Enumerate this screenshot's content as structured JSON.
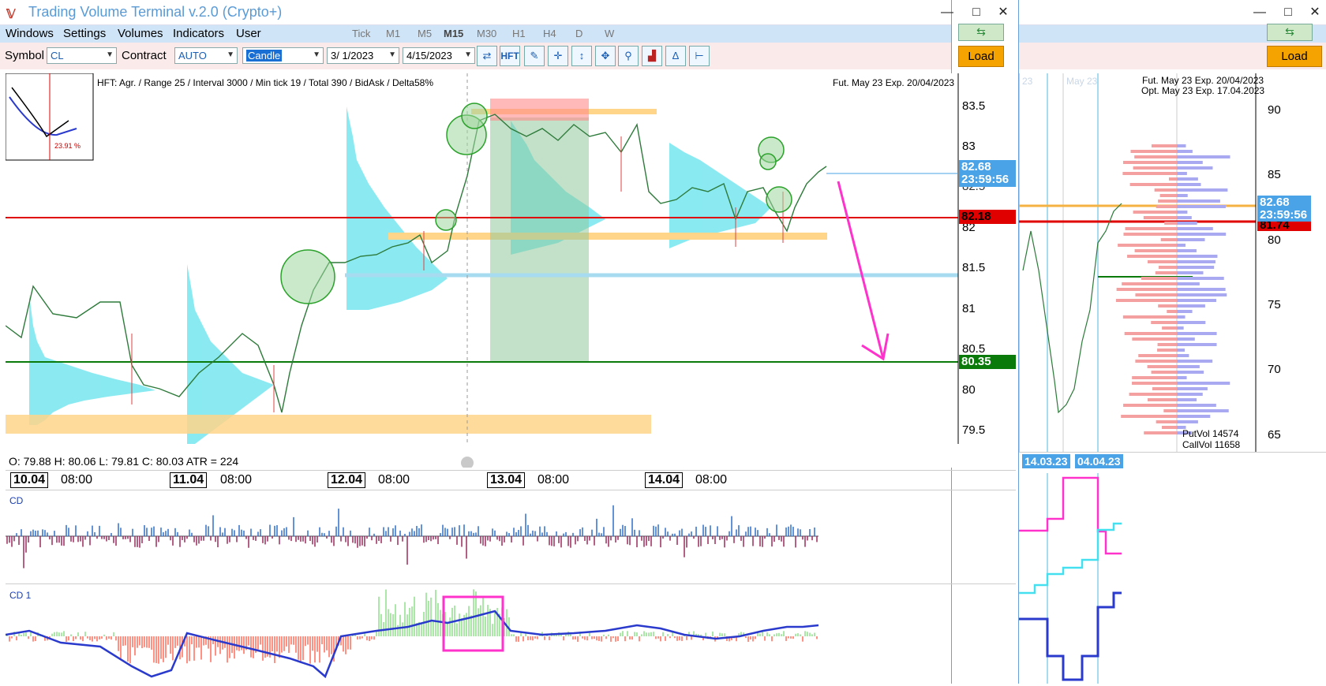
{
  "app": {
    "title": "Trading Volume Terminal v.2.0 (Crypto+)",
    "minimize": "—",
    "maximize": "□",
    "close": "✕"
  },
  "menu": [
    "Windows",
    "Settings",
    "Volumes",
    "Indicators",
    "User"
  ],
  "timeframes": [
    "Tick",
    "M1",
    "M5",
    "M15",
    "M30",
    "H1",
    "H4",
    "D",
    "W"
  ],
  "active_timeframe": "M15",
  "toolbar": {
    "symbol_label": "Symbol",
    "symbol_value": "CL",
    "contract_label": "Contract",
    "contract_value": "AUTO",
    "chart_type": "Candle",
    "date_from": "3/ 1/2023",
    "date_to": "4/15/2023",
    "hft_label": "HFT",
    "load_label": "Load",
    "tool_icons": [
      "arrows-icon",
      "hft-icon",
      "pen-icon",
      "crosshair-icon",
      "fit-vertical-icon",
      "move-icon",
      "zoom-icon",
      "bars-icon",
      "delta-icon",
      "range-icon"
    ]
  },
  "main_chart": {
    "info_line": "HFT: Agr. / Range 25 / Interval 3000 / Min tick 19 / Total 390 / BidAsk / Delta58%",
    "contract_info": "Fut. May 23 Exp. 20/04/2023",
    "inset_percent": "23.91 %",
    "price_ticks": [
      "83.5",
      "83",
      "82.5",
      "82",
      "81.5",
      "81",
      "80.5",
      "80",
      "79.5"
    ],
    "price_tag_current": "82.68",
    "price_tag_timer": "23:59:56",
    "price_tag_red": "82.18",
    "price_tag_green": "80.35",
    "ohlc": "O: 79.88  H: 80.06  L: 79.81  C: 80.03  ATR = 224",
    "dates": [
      {
        "day": "10.04",
        "time": "08:00"
      },
      {
        "day": "11.04",
        "time": "08:00"
      },
      {
        "day": "12.04",
        "time": "08:00"
      },
      {
        "day": "13.04",
        "time": "08:00"
      },
      {
        "day": "14.04",
        "time": "08:00"
      }
    ]
  },
  "indicators": {
    "cd_label": "CD",
    "cd1_label": "CD 1"
  },
  "right_chart": {
    "fut_info": "Fut. May 23 Exp. 20/04/2023",
    "opt_info": "Opt. May 23 Exp. 17.04.2023",
    "faded_labels": [
      "23",
      "May 23"
    ],
    "price_ticks": [
      "90",
      "85",
      "80",
      "75",
      "70",
      "65"
    ],
    "price_tag": "82.68",
    "price_tag_timer": "23:59:56",
    "price_tag_red": "81.74",
    "put_vol": "PutVol  14574",
    "call_vol": "CallVol  11658",
    "date_a": "14.03.23",
    "date_b": "04.04.23"
  },
  "colors": {
    "accent": "#5b9bd5",
    "load": "#f5a300",
    "red_line": "#e00000",
    "green_line": "#0a7a0a",
    "magenta": "#ff33cc",
    "profile": "#7ee8f0",
    "zone_orange": "#ffd58a",
    "tag_blue": "#4aa3e6"
  }
}
